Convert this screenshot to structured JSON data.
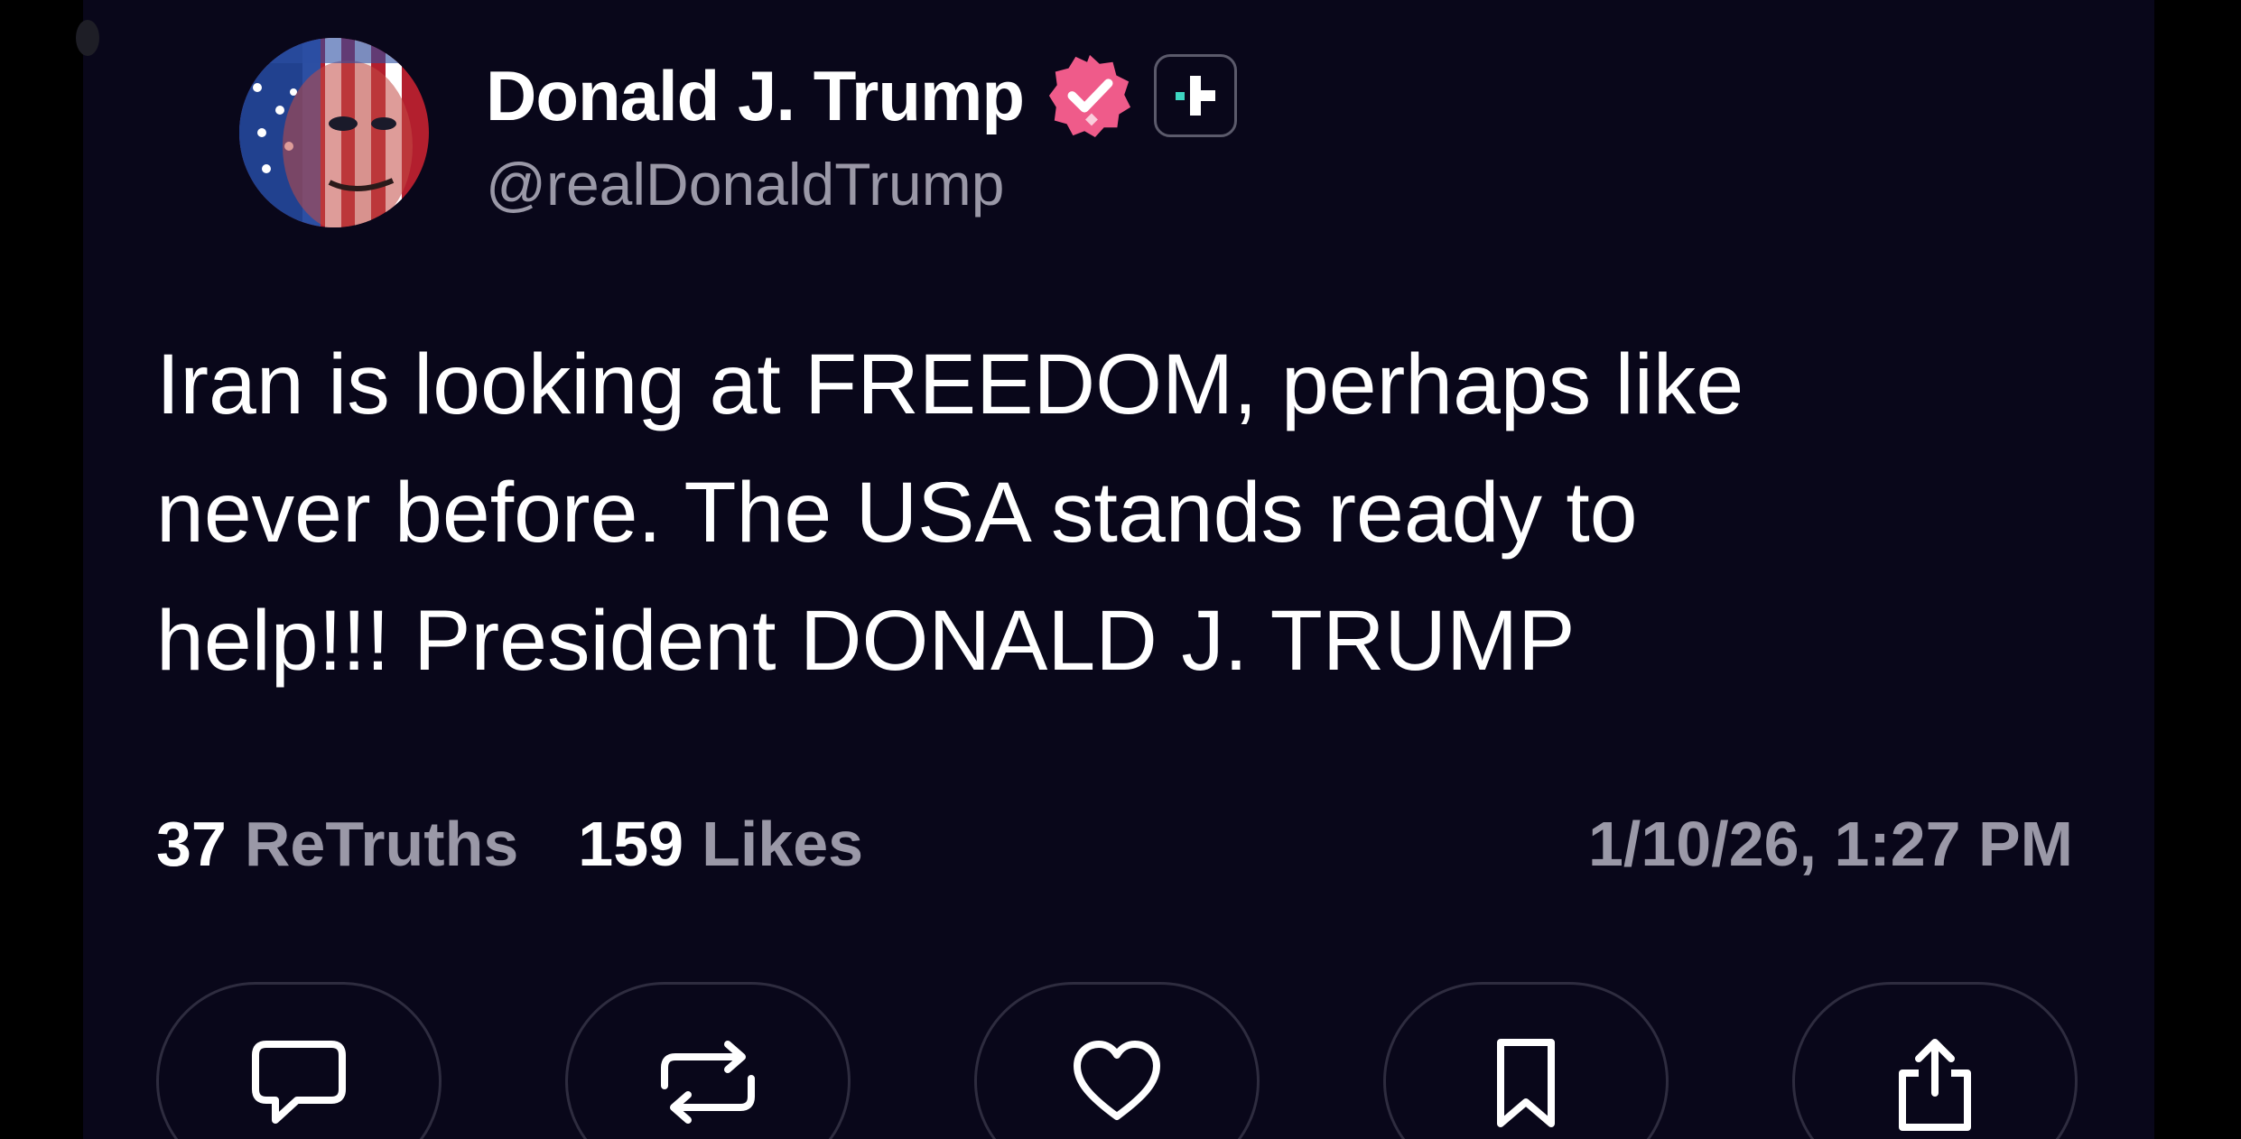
{
  "post": {
    "author": {
      "display_name": "Donald J. Trump",
      "handle": "@realDonaldTrump",
      "avatar_icon": "avatar-flag-portrait",
      "verified_icon": "verified-badge-icon",
      "plus_icon": "plus-badge-icon"
    },
    "text": "Iran is looking at FREEDOM, perhaps like\nnever before. The USA stands ready to\nhelp!!! President DONALD J. TRUMP",
    "stats": {
      "retruths_count": "37",
      "retruths_label": "ReTruths",
      "likes_count": "159",
      "likes_label": "Likes"
    },
    "timestamp": "1/10/26, 1:27 PM"
  },
  "actions": [
    {
      "icon": "reply-icon"
    },
    {
      "icon": "retruth-icon"
    },
    {
      "icon": "like-icon"
    },
    {
      "icon": "bookmark-icon"
    },
    {
      "icon": "share-icon"
    }
  ],
  "colors": {
    "background": "#09071a",
    "outer_background": "#000000",
    "primary_text": "#ffffff",
    "secondary_text": "#9a98a7",
    "verified_pink": "#ef5b8a",
    "plus_accent": "#3ed6c1",
    "button_border": "#2e2c3f"
  }
}
